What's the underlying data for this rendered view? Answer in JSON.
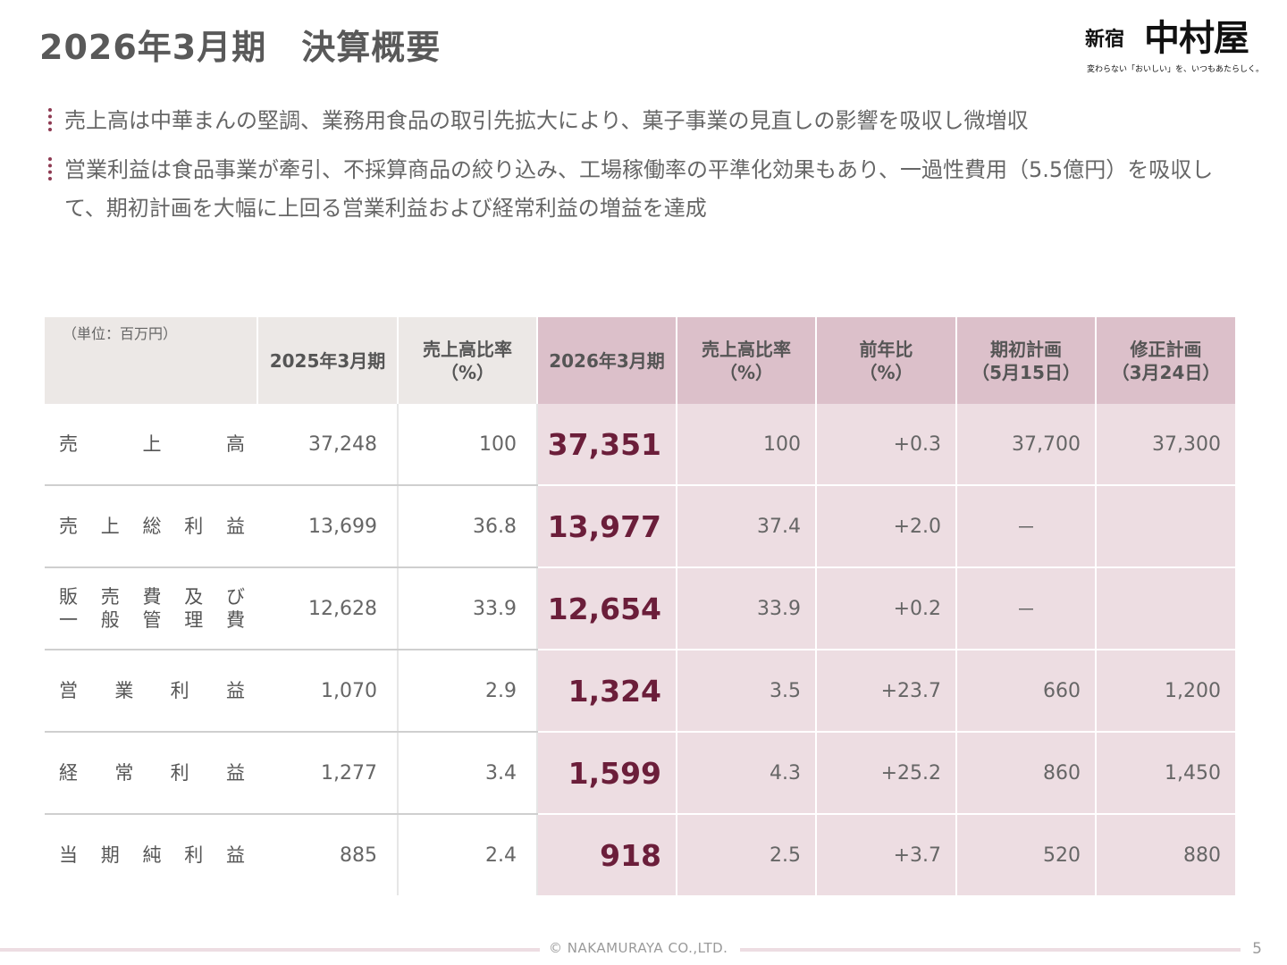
{
  "title": "2026年3月期　決算概要",
  "logo": {
    "small": "新宿",
    "main": "中村屋",
    "tagline": "変わらない「おいしい」を、いつもあたらしく。"
  },
  "bullets": [
    "売上高は中華まんの堅調、業務用食品の取引先拡大により、菓子事業の見直しの影響を吸収し微増収",
    "営業利益は食品事業が牽引、不採算商品の絞り込み、工場稼働率の平準化効果もあり、一過性費用（5.5億円）を吸収して、期初計画を大幅に上回る営業利益および経常利益の増益を達成"
  ],
  "table": {
    "unit": "（単位：百万円）",
    "headers": [
      {
        "line1": "2025年3月期",
        "line2": ""
      },
      {
        "line1": "売上高比率",
        "line2": "（%）"
      },
      {
        "line1": "2026年3月期",
        "line2": ""
      },
      {
        "line1": "売上高比率",
        "line2": "（%）"
      },
      {
        "line1": "前年比",
        "line2": "（%）"
      },
      {
        "line1": "期初計画",
        "line2": "（5月15日）"
      },
      {
        "line1": "修正計画",
        "line2": "（3月24日）"
      }
    ],
    "rows": [
      {
        "label_lines": [
          [
            "売",
            "上",
            "高"
          ]
        ],
        "prev": "37,248",
        "prev_ratio": "100",
        "cur": "37,351",
        "cur_ratio": "100",
        "yoy": "+0.3",
        "plan": "37,700",
        "revised": "37,300"
      },
      {
        "label_lines": [
          [
            "売",
            "上",
            "総",
            "利",
            "益"
          ]
        ],
        "prev": "13,699",
        "prev_ratio": "36.8",
        "cur": "13,977",
        "cur_ratio": "37.4",
        "yoy": "+2.0",
        "plan": "－",
        "revised": ""
      },
      {
        "label_lines": [
          [
            "販",
            "売",
            "費",
            "及",
            "び"
          ],
          [
            "一",
            "般",
            "管",
            "理",
            "費"
          ]
        ],
        "prev": "12,628",
        "prev_ratio": "33.9",
        "cur": "12,654",
        "cur_ratio": "33.9",
        "yoy": "+0.2",
        "plan": "－",
        "revised": ""
      },
      {
        "label_lines": [
          [
            "営",
            "業",
            "利",
            "益"
          ]
        ],
        "prev": "1,070",
        "prev_ratio": "2.9",
        "cur": "1,324",
        "cur_ratio": "3.5",
        "yoy": "+23.7",
        "plan": "660",
        "revised": "1,200"
      },
      {
        "label_lines": [
          [
            "経",
            "常",
            "利",
            "益"
          ]
        ],
        "prev": "1,277",
        "prev_ratio": "3.4",
        "cur": "1,599",
        "cur_ratio": "4.3",
        "yoy": "+25.2",
        "plan": "860",
        "revised": "1,450"
      },
      {
        "label_lines": [
          [
            "当",
            "期",
            "純",
            "利",
            "益"
          ]
        ],
        "prev": "885",
        "prev_ratio": "2.4",
        "cur": "918",
        "cur_ratio": "2.5",
        "yoy": "+3.7",
        "plan": "520",
        "revised": "880"
      }
    ]
  },
  "footer": {
    "copyright": "© NAKAMURAYA CO.,LTD.",
    "page": "5"
  }
}
